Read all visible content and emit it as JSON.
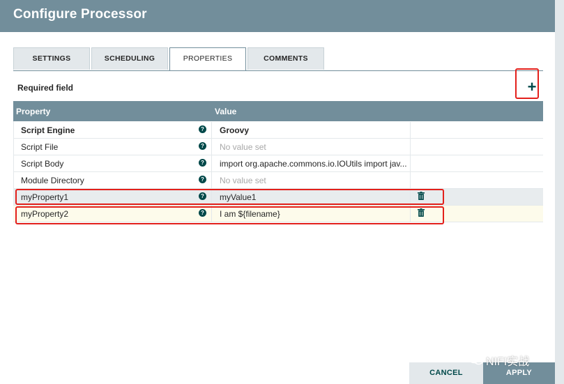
{
  "dialog": {
    "title": "Configure Processor"
  },
  "tabs": [
    {
      "label": "SETTINGS",
      "active": false
    },
    {
      "label": "SCHEDULING",
      "active": false
    },
    {
      "label": "PROPERTIES",
      "active": true
    },
    {
      "label": "COMMENTS",
      "active": false
    }
  ],
  "required_label": "Required field",
  "add_icon": "+",
  "table": {
    "headers": [
      "Property",
      "Value"
    ],
    "rows": [
      {
        "name": "Script Engine",
        "value": "Groovy",
        "required": true,
        "help_icon": "?"
      },
      {
        "name": "Script File",
        "value": "No value set",
        "required": false,
        "help_icon": "?"
      },
      {
        "name": "Script Body",
        "value": "import org.apache.commons.io.IOUtils import jav...",
        "required": false,
        "help_icon": "?"
      },
      {
        "name": "Module Directory",
        "value": "No value set",
        "required": false,
        "help_icon": "?"
      },
      {
        "name": "myProperty1",
        "value": "myValue1",
        "required": false,
        "help_icon": "?",
        "deletable": true
      },
      {
        "name": "myProperty2",
        "value": "I am ${filename}",
        "required": false,
        "help_icon": "?",
        "deletable": true
      }
    ]
  },
  "buttons": {
    "cancel": "CANCEL",
    "apply": "APPLY"
  },
  "watermark": "NIFI实战",
  "colors": {
    "header": "#728e9b",
    "accent": "#004849",
    "highlight": "#e3201b",
    "new_row": "#fdfbeb"
  }
}
